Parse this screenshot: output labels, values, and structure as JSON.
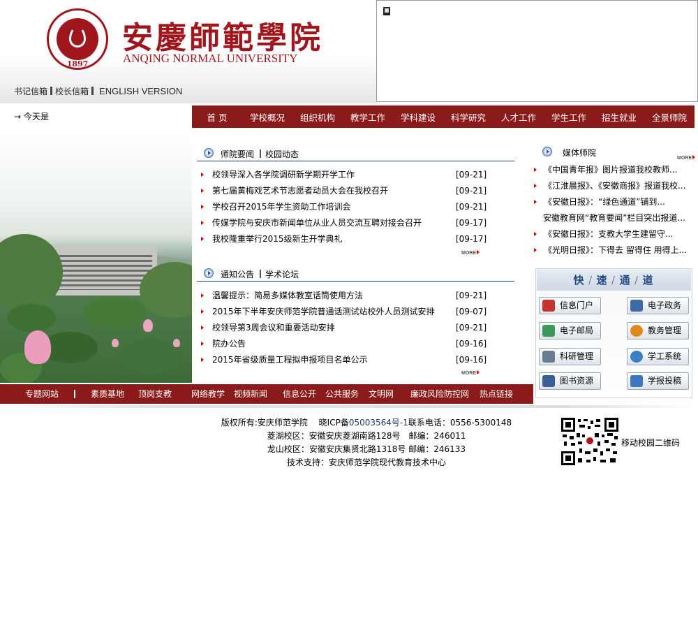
{
  "header": {
    "logo_cn": "安慶師範學院",
    "logo_en": "ANQING NORMAL UNIVERSITY",
    "logo_year": "1897",
    "top_links": [
      "书记信箱",
      "校长信箱",
      "ENGLISH VERSION"
    ]
  },
  "date_label": "→ 今天是",
  "nav": [
    "首 页",
    "学校概况",
    "组织机构",
    "教学工作",
    "学科建设",
    "科学研究",
    "人才工作",
    "学生工作",
    "招生就业",
    "全景师院"
  ],
  "news": {
    "tab1": "师院要闻",
    "tab2": "校园动态",
    "more": "MORE",
    "items": [
      {
        "title": "校领导深入各学院调研新学期开学工作",
        "date": "[09-21]"
      },
      {
        "title": "第七届黄梅戏艺术节志愿者动员大会在我校召开",
        "date": "[09-21]"
      },
      {
        "title": "学校召开2015年学生资助工作培训会",
        "date": "[09-21]"
      },
      {
        "title": "传媒学院与安庆市新闻单位从业人员交流互聘对接会召开",
        "date": "[09-17]"
      },
      {
        "title": "我校隆重举行2015级新生开学典礼",
        "date": "[09-17]"
      }
    ]
  },
  "notices": {
    "tab1": "通知公告",
    "tab2": "学术论坛",
    "more": "MORE",
    "items": [
      {
        "title": "温馨提示：简易多媒体教室话筒使用方法",
        "date": "[09-21]"
      },
      {
        "title": "2015年下半年安庆师范学院普通话测试站校外人员测试安排",
        "date": "[09-07]"
      },
      {
        "title": "校领导第3周会议和重要活动安排",
        "date": "[09-21]"
      },
      {
        "title": "院办公告",
        "date": "[09-16]"
      },
      {
        "title": "2015年省级质量工程拟申报项目名单公示",
        "date": "[09-16]"
      }
    ]
  },
  "media": {
    "title": "媒体师院",
    "more": "MORE",
    "items": [
      "《中国青年报》图片报道我校教师...",
      "《江淮晨报》、《安徽商报》报道我校...",
      "《安徽日报》：“绿色通道”铺到...",
      "安徽教育网“教育要闻”栏目突出报道...",
      "《安徽日报》：支教大学生建留守...",
      "《光明日报》：下得去 留得住 用得上..."
    ]
  },
  "quick": {
    "title": [
      "快",
      "速",
      "通",
      "道"
    ],
    "buttons": [
      {
        "label": "信息门户",
        "icon": "house-icon",
        "color": "#c8322c"
      },
      {
        "label": "电子政务",
        "icon": "monitor-icon",
        "color": "#3f6aa8"
      },
      {
        "label": "电子邮局",
        "icon": "mail-house-icon",
        "color": "#3b9a5b"
      },
      {
        "label": "教务管理",
        "icon": "pie-chart-icon",
        "color": "#e08a1c"
      },
      {
        "label": "科研管理",
        "icon": "computer-icon",
        "color": "#6a7d90"
      },
      {
        "label": "学工系统",
        "icon": "globe-icon",
        "color": "#3d7fc4"
      },
      {
        "label": "图书资源",
        "icon": "book-icon",
        "color": "#3a5f96"
      },
      {
        "label": "学报投稿",
        "icon": "envelope-icon",
        "color": "#3b78c0"
      }
    ]
  },
  "links": [
    "专题网站",
    "素质基地",
    "顶岗支教",
    "网络教学",
    "视频新闻",
    "信息公开",
    "公共服务",
    "文明网",
    "廉政风险防控网",
    "热点链接"
  ],
  "footer": {
    "copyright": "版权所有:安庆师范学院",
    "icp_prefix": "晓ICP备",
    "icp_number": "05003564号-1",
    "phone": "联系电话：0556-5300148",
    "campus1": "菱湖校区：安徽安庆菱湖南路128号　邮编：246011",
    "campus2": "龙山校区：安徽安庆集贤北路1318号 邮编：246133",
    "support": "技术支持：安庆师范学院现代教育技术中心",
    "qr_label": "移动校园二维码"
  }
}
